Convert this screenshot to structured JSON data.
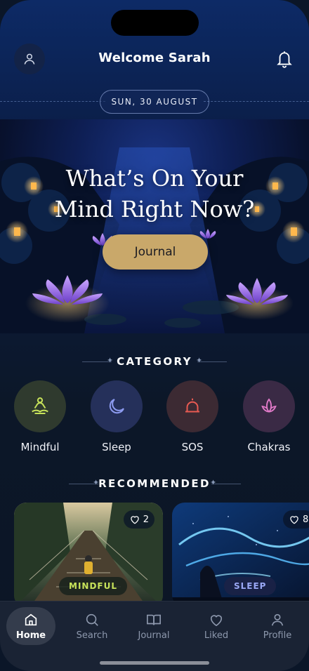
{
  "header": {
    "title": "Welcome Sarah",
    "date": "SUN, 30 AUGUST"
  },
  "hero": {
    "line1": "What’s On Your",
    "line2": "Mind Right Now?",
    "button": "Journal"
  },
  "category": {
    "heading": "CATEGORY",
    "items": [
      {
        "label": "Mindful",
        "icon": "meditation-icon",
        "bg": "#2f3a2e",
        "color": "#c7e25a"
      },
      {
        "label": "Sleep",
        "icon": "moon-icon",
        "bg": "#25305a",
        "color": "#8d9bf0"
      },
      {
        "label": "SOS",
        "icon": "alarm-bell-icon",
        "bg": "#3c2a33",
        "color": "#e85a52"
      },
      {
        "label": "Chakras",
        "icon": "lotus-icon",
        "bg": "#3a2a45",
        "color": "#e07ac8"
      }
    ]
  },
  "recommended": {
    "heading": "RECOMMENDED",
    "cards": [
      {
        "likes": "2",
        "tag": "MINDFUL",
        "tag_color": "#c7e25a"
      },
      {
        "likes": "8",
        "tag": "SLEEP",
        "tag_color": "#9aa8f5"
      }
    ]
  },
  "tabs": [
    {
      "label": "Home",
      "icon": "home-icon",
      "active": true
    },
    {
      "label": "Search",
      "icon": "search-icon",
      "active": false
    },
    {
      "label": "Journal",
      "icon": "book-icon",
      "active": false
    },
    {
      "label": "Liked",
      "icon": "heart-icon",
      "active": false
    },
    {
      "label": "Profile",
      "icon": "user-icon",
      "active": false
    }
  ]
}
